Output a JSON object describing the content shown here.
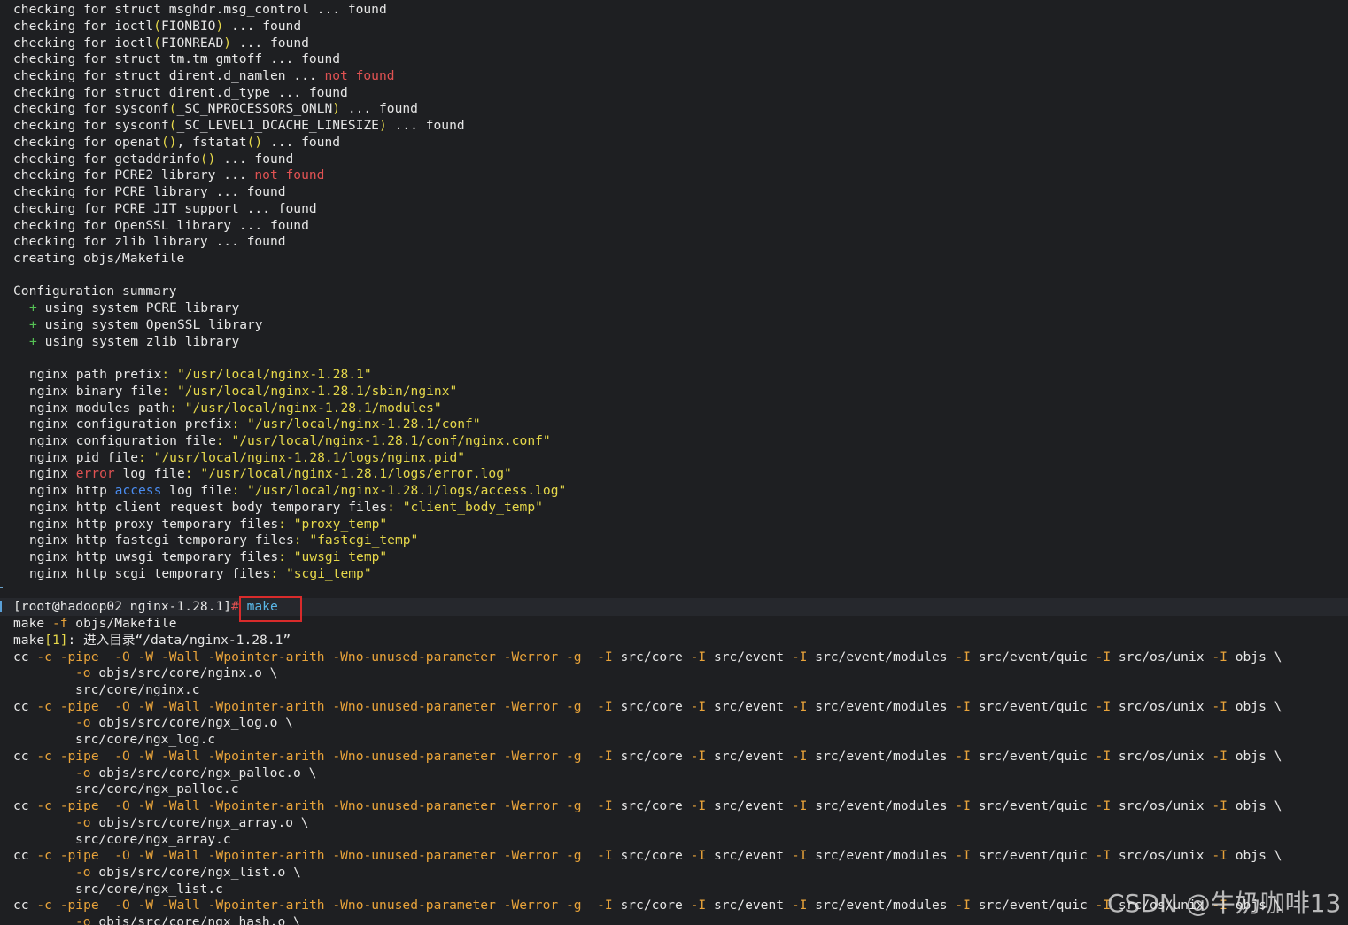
{
  "checks": [
    {
      "pre": "checking for struct msghdr.msg_control ... ",
      "status": "found",
      "status_color": "normal"
    },
    {
      "pre": "checking for ioctl",
      "args": "FIONBIO",
      "mid": " ... ",
      "status": "found",
      "status_color": "normal"
    },
    {
      "pre": "checking for ioctl",
      "args": "FIONREAD",
      "mid": " ... ",
      "status": "found",
      "status_color": "normal"
    },
    {
      "pre": "checking for struct tm.tm_gmtoff ... ",
      "status": "found",
      "status_color": "normal"
    },
    {
      "pre": "checking for struct dirent.d_namlen ... ",
      "status": "not found",
      "status_color": "red"
    },
    {
      "pre": "checking for struct dirent.d_type ... ",
      "status": "found",
      "status_color": "normal"
    },
    {
      "pre": "checking for sysconf",
      "args": "_SC_NPROCESSORS_ONLN",
      "mid": " ... ",
      "status": "found",
      "status_color": "normal"
    },
    {
      "pre": "checking for sysconf",
      "args": "_SC_LEVEL1_DCACHE_LINESIZE",
      "mid": " ... ",
      "status": "found",
      "status_color": "normal"
    },
    {
      "pre": "checking for openat",
      "args": "",
      "mid2": ", fstatat",
      "status": "found",
      "status_color": "normal"
    },
    {
      "pre": "checking for getaddrinfo",
      "args": "",
      "mid": " ... ",
      "status": "found",
      "status_color": "normal"
    },
    {
      "pre": "checking for PCRE2 library ... ",
      "status": "not found",
      "status_color": "red"
    },
    {
      "pre": "checking for PCRE library ... ",
      "status": "found",
      "status_color": "normal"
    },
    {
      "pre": "checking for PCRE JIT support ... ",
      "status": "found",
      "status_color": "normal"
    },
    {
      "pre": "checking for OpenSSL library ... ",
      "status": "found",
      "status_color": "normal"
    },
    {
      "pre": "checking for zlib library ... ",
      "status": "found",
      "status_color": "normal"
    }
  ],
  "creating": "creating objs/Makefile",
  "summary_title": "Configuration summary",
  "summary_items": [
    "using system PCRE library",
    "using system OpenSSL library",
    "using system zlib library"
  ],
  "paths": [
    {
      "a": "nginx path prefix",
      "v": "\"/usr/local/nginx-1.28.1\""
    },
    {
      "a": "nginx binary file",
      "v": "\"/usr/local/nginx-1.28.1/sbin/nginx\""
    },
    {
      "a": "nginx modules path",
      "v": "\"/usr/local/nginx-1.28.1/modules\""
    },
    {
      "a": "nginx configuration prefix",
      "v": "\"/usr/local/nginx-1.28.1/conf\""
    },
    {
      "a": "nginx configuration file",
      "v": "\"/usr/local/nginx-1.28.1/conf/nginx.conf\""
    },
    {
      "a": "nginx pid file",
      "v": "\"/usr/local/nginx-1.28.1/logs/nginx.pid\""
    },
    {
      "a": "nginx ",
      "kw": "error",
      "kwc": "red",
      "b": " log file",
      "v": "\"/usr/local/nginx-1.28.1/logs/error.log\""
    },
    {
      "a": "nginx http ",
      "kw": "access",
      "kwc": "blue",
      "b": " log file",
      "v": "\"/usr/local/nginx-1.28.1/logs/access.log\""
    },
    {
      "a": "nginx http client request body temporary files",
      "v": "\"client_body_temp\""
    },
    {
      "a": "nginx http proxy temporary files",
      "v": "\"proxy_temp\""
    },
    {
      "a": "nginx http fastcgi temporary files",
      "v": "\"fastcgi_temp\""
    },
    {
      "a": "nginx http uwsgi temporary files",
      "v": "\"uwsgi_temp\""
    },
    {
      "a": "nginx http scgi temporary files",
      "v": "\"scgi_temp\""
    }
  ],
  "prompt": {
    "text": "[root@hadoop02 nginx-1.28.1]",
    "hash": "#",
    "command": "make"
  },
  "make_line": {
    "a": "make ",
    "flag": "-f",
    "b": " objs/Makefile"
  },
  "make_enter": {
    "a": "make",
    "num": "[1]",
    "b": ": 进入目录“/data/nginx-1.28.1”"
  },
  "cc_flags": "-c -pipe  -O -W -Wall -Wpointer-arith -Wno-unused-parameter -Werror -g",
  "cc_includes": "src/core -I src/event -I src/event/modules -I src/event/quic -I src/os/unix -I objs \\",
  "compile_units": [
    {
      "obj": "objs/src/core/nginx.o \\",
      "src": "src/core/nginx.c"
    },
    {
      "obj": "objs/src/core/ngx_log.o \\",
      "src": "src/core/ngx_log.c"
    },
    {
      "obj": "objs/src/core/ngx_palloc.o \\",
      "src": "src/core/ngx_palloc.c"
    },
    {
      "obj": "objs/src/core/ngx_array.o \\",
      "src": "src/core/ngx_array.c"
    },
    {
      "obj": "objs/src/core/ngx_list.o \\",
      "src": "src/core/ngx_list.c"
    },
    {
      "obj": "objs/src/core/ngx_hash.o \\",
      "src": ""
    }
  ],
  "watermark": "CSDN @牛奶咖啡13",
  "colors": {
    "background": "#1e1f22",
    "text": "#e6e6e6",
    "yellow": "#e6d84a",
    "red": "#e05252",
    "green": "#55c255",
    "blue": "#4a8cf0",
    "orange": "#e8a33a",
    "cyan": "#5ab8e8",
    "highlight": "#d92b2b"
  }
}
